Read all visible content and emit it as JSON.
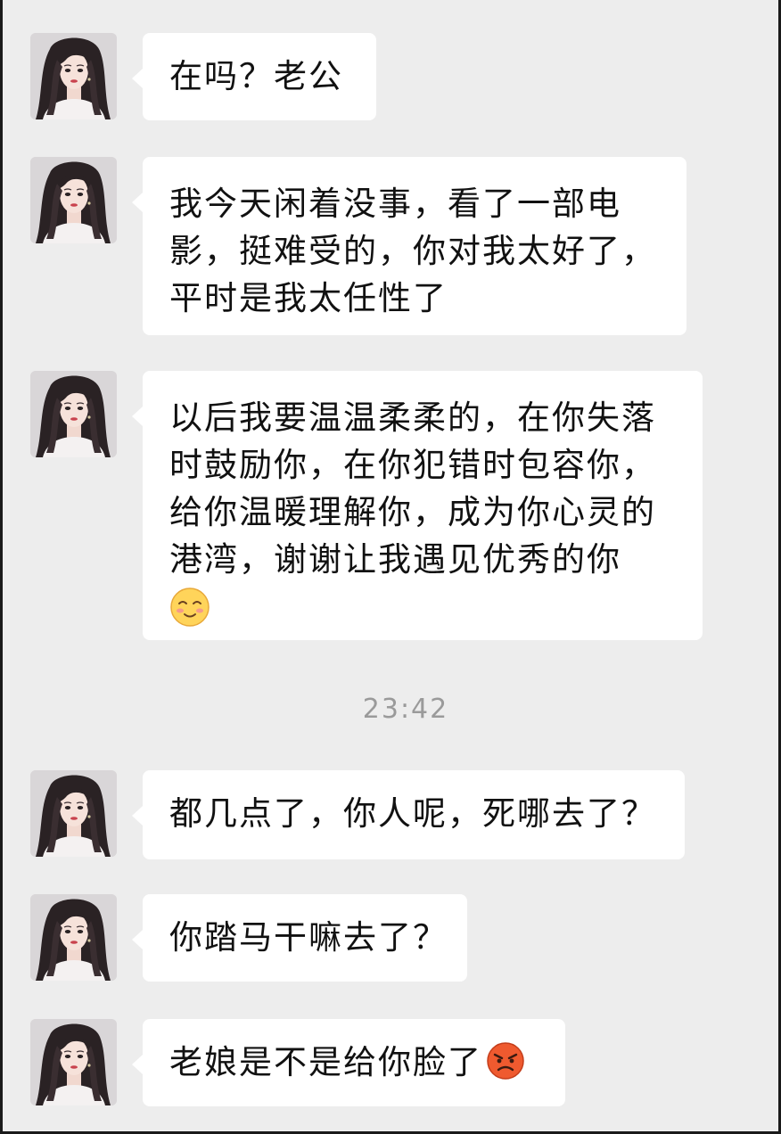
{
  "chat": {
    "sender_avatar_icon": "avatar-photo",
    "messages": [
      {
        "lines": [
          "在吗？老公"
        ]
      },
      {
        "lines": [
          "我今天闲着没事，看了一部电",
          "影，挺难受的，你对我太好了，",
          "平时是我太任性了"
        ]
      },
      {
        "lines": [
          "以后我要温温柔柔的，在你失落",
          "时鼓励你，在你犯错时包容你，",
          "给你温暖理解你，成为你心灵的",
          "港湾，谢谢让我遇见优秀的你"
        ],
        "emoji": "shy-smile-emoji"
      },
      {
        "lines": [
          "都几点了，你人呢，死哪去了？"
        ]
      },
      {
        "lines": [
          "你踏马干嘛去了？"
        ]
      },
      {
        "lines": [
          "老娘是不是给你脸了"
        ],
        "emoji": "angry-face-emoji"
      }
    ],
    "timestamp": "23:42"
  },
  "colors": {
    "background": "#ededed",
    "bubble": "#ffffff",
    "text": "#111111",
    "timestamp": "#9a9a9a"
  }
}
